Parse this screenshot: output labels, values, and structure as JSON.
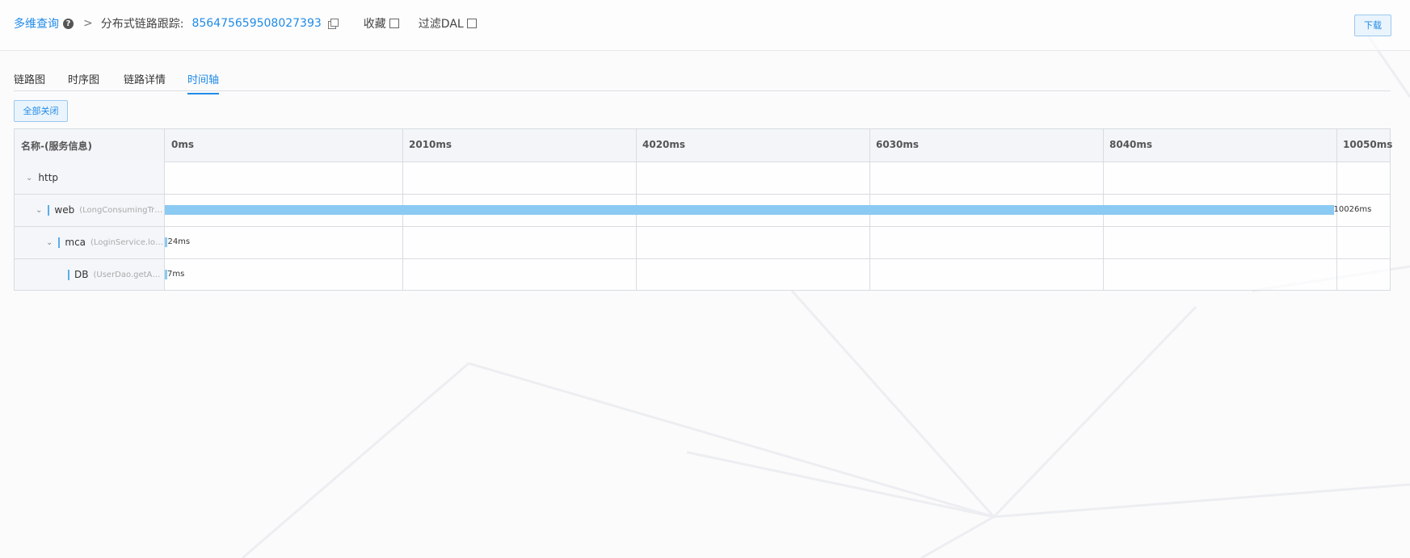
{
  "header": {
    "home": "多维查询",
    "section": "分布式链路跟踪:",
    "trace_id": "856475659508027393",
    "favorite_label": "收藏",
    "filter_label": "过滤DAL",
    "download_label": "下载"
  },
  "tabs": [
    {
      "label": "链路图",
      "active": false
    },
    {
      "label": "时序图",
      "active": false
    },
    {
      "label": "链路详情",
      "active": false
    },
    {
      "label": "时间轴",
      "active": true
    }
  ],
  "collapse_all_label": "全部关闭",
  "timeline": {
    "name_header": "名称-(服务信息)",
    "ticks": [
      "0ms",
      "2010ms",
      "4020ms",
      "6030ms",
      "8040ms",
      "10050ms"
    ],
    "total_ms": 10050,
    "rows": [
      {
        "name": "http",
        "info": "",
        "duration": "",
        "start_ms": null,
        "duration_ms": null,
        "level": 0,
        "has_children": true
      },
      {
        "name": "web",
        "info": "(LongConsumingTr…",
        "duration": "10026ms",
        "start_ms": 0,
        "duration_ms": 10026,
        "level": 1,
        "has_children": true
      },
      {
        "name": "mca",
        "info": "(LoginService.lo…",
        "duration": "24ms",
        "start_ms": 0,
        "duration_ms": 24,
        "level": 2,
        "has_children": true
      },
      {
        "name": "DB",
        "info": "(UserDao.getA…",
        "duration": "7ms",
        "start_ms": 0,
        "duration_ms": 7,
        "level": 3,
        "has_children": false
      }
    ]
  },
  "colors": {
    "accent": "#1f8ae6",
    "bar": "#8bcaf3",
    "grid_line": "#d8dce1"
  }
}
